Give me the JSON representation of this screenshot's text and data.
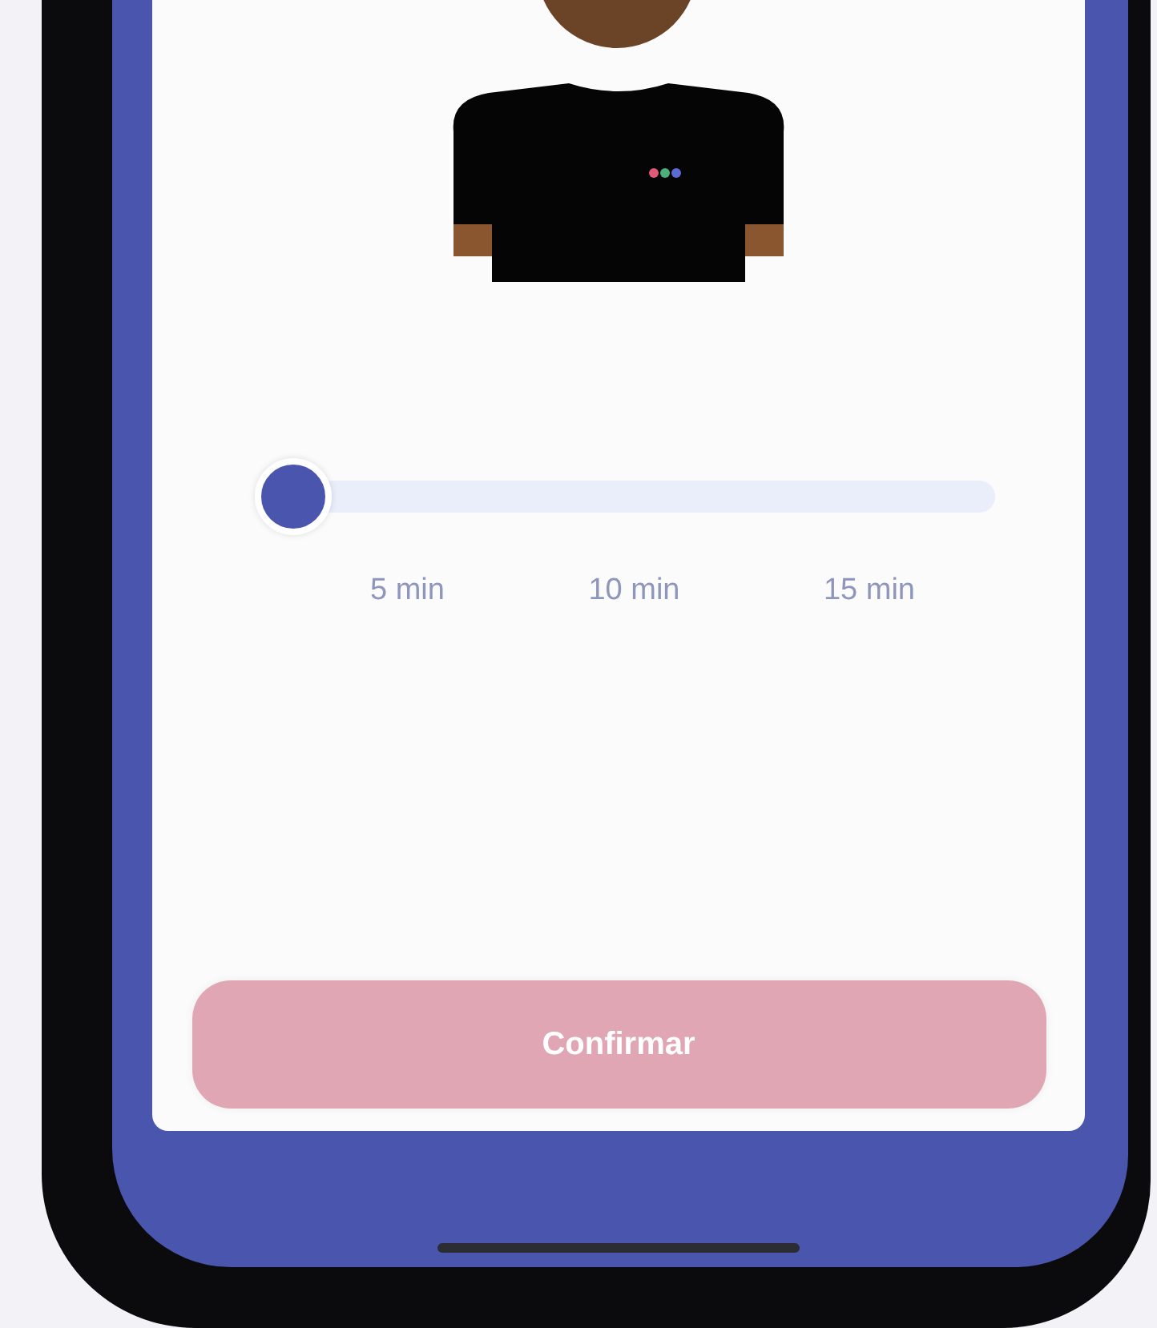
{
  "duration_slider": {
    "level": 0,
    "ticks": [
      "5 min",
      "10 min",
      "15 min"
    ]
  },
  "confirm_button": {
    "label": "Confirmar",
    "disabled": true
  }
}
